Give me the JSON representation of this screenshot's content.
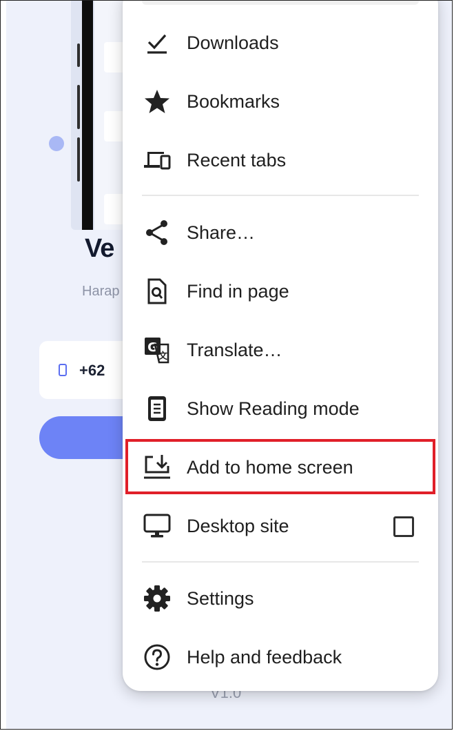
{
  "background_page": {
    "title_partial": "Ve",
    "subtitle_partial": "Harap",
    "phone_code": "+62",
    "version": "V1.0"
  },
  "menu": {
    "items": [
      {
        "id": "downloads",
        "label": "Downloads",
        "icon": "download-done-icon"
      },
      {
        "id": "bookmarks",
        "label": "Bookmarks",
        "icon": "star-icon"
      },
      {
        "id": "recent-tabs",
        "label": "Recent tabs",
        "icon": "devices-icon"
      },
      {
        "id": "share",
        "label": "Share…",
        "icon": "share-icon"
      },
      {
        "id": "find-in-page",
        "label": "Find in page",
        "icon": "find-in-page-icon"
      },
      {
        "id": "translate",
        "label": "Translate…",
        "icon": "translate-icon"
      },
      {
        "id": "reading-mode",
        "label": "Show Reading mode",
        "icon": "reading-mode-icon"
      },
      {
        "id": "add-to-home",
        "label": "Add to home screen",
        "icon": "add-to-home-screen-icon",
        "highlighted": true
      },
      {
        "id": "desktop-site",
        "label": "Desktop site",
        "icon": "desktop-icon",
        "checkbox": true,
        "checked": false
      },
      {
        "id": "settings",
        "label": "Settings",
        "icon": "gear-icon"
      },
      {
        "id": "help",
        "label": "Help and feedback",
        "icon": "help-icon"
      }
    ]
  },
  "colors": {
    "highlight_border": "#e01f29",
    "accent": "#6d83f6",
    "page_background": "#eef1fb"
  }
}
